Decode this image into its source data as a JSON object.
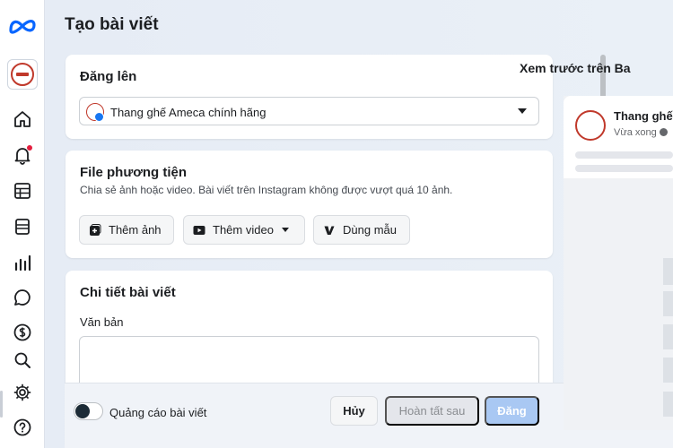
{
  "page": {
    "title": "Tạo bài viết"
  },
  "sidebar": {
    "items": [
      {
        "name": "home"
      },
      {
        "name": "notifications",
        "has_dot": true
      },
      {
        "name": "planner"
      },
      {
        "name": "content"
      },
      {
        "name": "insights"
      },
      {
        "name": "messages"
      },
      {
        "name": "monetization"
      },
      {
        "name": "search"
      },
      {
        "name": "settings"
      },
      {
        "name": "help"
      }
    ]
  },
  "post_to": {
    "title": "Đăng lên",
    "selected": "Thang ghế Ameca chính hãng"
  },
  "media": {
    "title": "File phương tiện",
    "subtitle": "Chia sẻ ảnh hoặc video. Bài viết trên Instagram không được vượt quá 10 ảnh.",
    "add_photo": "Thêm ảnh",
    "add_video": "Thêm video",
    "use_template": "Dùng mẫu"
  },
  "details": {
    "title": "Chi tiết bài viết",
    "text_label": "Văn bản",
    "text_value": ""
  },
  "footer": {
    "boost_label": "Quảng cáo bài viết",
    "boost_on": false,
    "cancel": "Hủy",
    "finish_later": "Hoàn tất sau",
    "publish": "Đăng"
  },
  "preview": {
    "title": "Xem trước trên Ba",
    "page_name": "Thang ghế",
    "time": "Vừa xong"
  },
  "colors": {
    "brand_blue": "#1877f2",
    "publish_disabled": "#a9c8f3",
    "notif_red": "#e41e3f",
    "avatar_red": "#c0392b"
  }
}
